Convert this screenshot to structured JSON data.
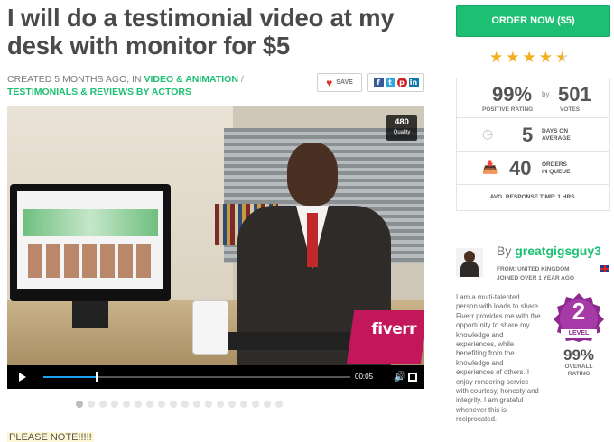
{
  "gig": {
    "title": "I will do a testimonial video at my desk with monitor for $5",
    "created": "CREATED 5 MONTHS AGO, IN",
    "category": "VIDEO & ANIMATION",
    "separator": "/",
    "subcategory": "TESTIMONIALS & REVIEWS BY ACTORS",
    "save_label": "SAVE",
    "note": "PLEASE NOTE!!!!!"
  },
  "icons": {
    "save": "heart-icon",
    "facebook": "facebook-icon",
    "twitter": "twitter-icon",
    "pinterest": "pinterest-icon",
    "linkedin": "linkedin-icon",
    "play": "play-icon",
    "volume": "volume-icon",
    "fullscreen": "fullscreen-icon",
    "days": "clock-icon",
    "queue": "inbox-icon"
  },
  "video": {
    "quality_value": "480",
    "quality_label": "Quality",
    "time": "00:05",
    "progress": 0.17,
    "watermark": "fiverr",
    "slides": 18,
    "active_slide": 0
  },
  "order": {
    "label": "ORDER NOW ($5)"
  },
  "rating": {
    "stars": 4.5
  },
  "stats": {
    "positive_value": "99%",
    "positive_label": "POSITIVE RATING",
    "by": "by",
    "votes_value": "501",
    "votes_label": "VOTES",
    "days_value": "5",
    "days_label_1": "DAYS ON",
    "days_label_2": "AVERAGE",
    "queue_value": "40",
    "queue_label_1": "ORDERS",
    "queue_label_2": "IN QUEUE",
    "response_label": "AVG. RESPONSE TIME:",
    "response_value": "1 HRS."
  },
  "seller": {
    "by": "By",
    "name": "greatgigsguy3",
    "from_label": "FROM:",
    "from_value": "UNITED KINGDOM",
    "joined": "JOINED OVER 1 YEAR AGO",
    "bio": "I am a multi-talented person with loads to share. Fiverr provides me with the opportunity to share my knowledge and experiences, while benefiting from the knowledge and experiences of others. I enjoy rendering service with courtesy, honesty and integrity. I am grateful whenever this is reciprocated.",
    "level_number": "2",
    "level_label": "LEVEL",
    "overall_value": "99%",
    "overall_label_1": "OVERALL",
    "overall_label_2": "RATING"
  },
  "colors": {
    "brand_green": "#1dbf73",
    "badge_purple": "#8e2a8f",
    "star_gold": "#f2b01e"
  }
}
